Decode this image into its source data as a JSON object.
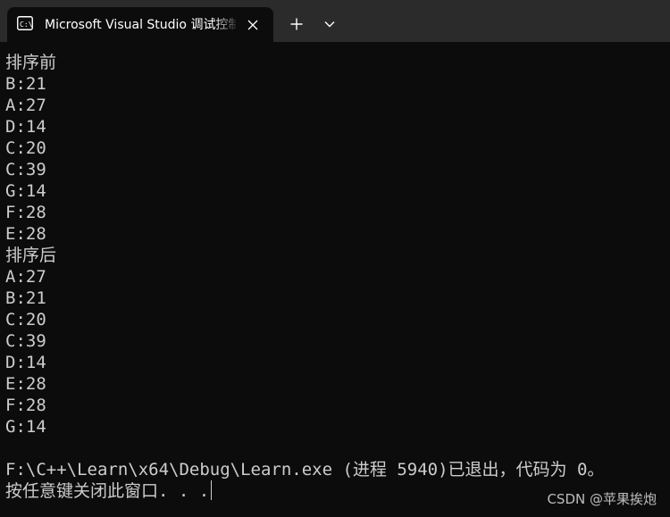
{
  "tab": {
    "title": "Microsoft Visual Studio 调试控制台",
    "icon": "terminal-icon"
  },
  "toolbar": {
    "new_tab_icon": "plus-icon",
    "dropdown_icon": "chevron-down-icon"
  },
  "output": {
    "before_label": "排序前",
    "before_items": [
      "B:21",
      "A:27",
      "D:14",
      "C:20",
      "C:39",
      "G:14",
      "F:28",
      "E:28"
    ],
    "after_label": "排序后",
    "after_items": [
      "A:27",
      "B:21",
      "C:20",
      "C:39",
      "D:14",
      "E:28",
      "F:28",
      "G:14"
    ],
    "exit_message": "F:\\C++\\Learn\\x64\\Debug\\Learn.exe (进程 5940)已退出，代码为 0。",
    "prompt": "按任意键关闭此窗口. . ."
  },
  "watermark": "CSDN @苹果挨炮",
  "colors": {
    "background": "#0c0c0c",
    "tabbar": "#2b2b2b",
    "text": "#cccccc"
  }
}
